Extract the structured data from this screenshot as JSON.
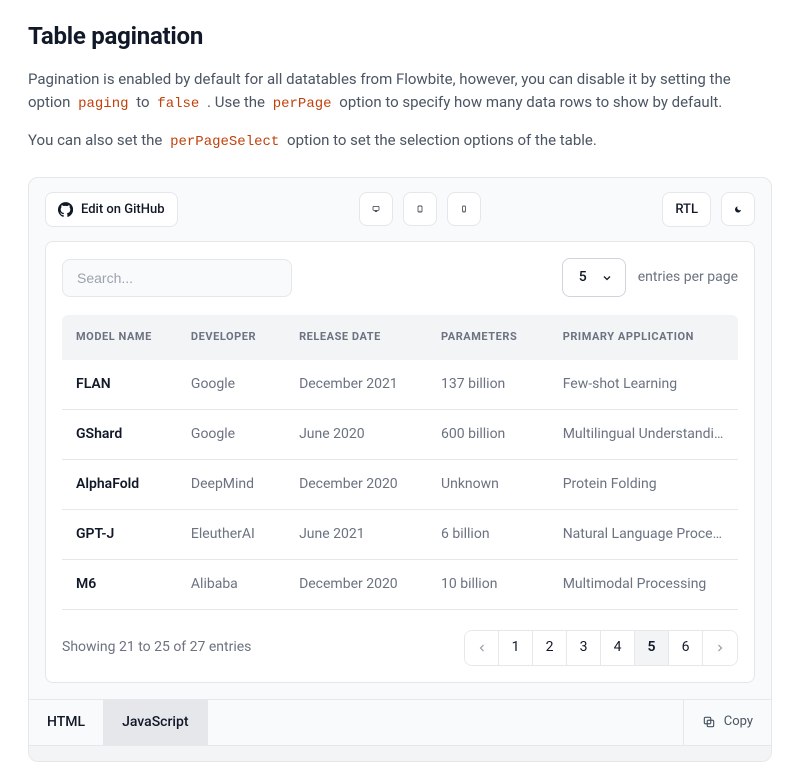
{
  "heading": "Table pagination",
  "intro_segments": {
    "p1a": "Pagination is enabled by default for all datatables from Flowbite, however, you can disable it by setting the option ",
    "code_paging": "paging",
    "p1b": " to ",
    "code_false": "false",
    "p1c": ". Use the ",
    "code_perPage": "perPage",
    "p1d": " option to specify how many data rows to show by default.",
    "p2a": "You can also set the ",
    "code_perPageSelect": "perPageSelect",
    "p2b": " option to set the selection options of the table."
  },
  "toolbar": {
    "edit_label": "Edit on GitHub",
    "rtl_label": "RTL"
  },
  "search": {
    "placeholder": "Search..."
  },
  "per_page": {
    "value": "5",
    "label": "entries per page"
  },
  "columns": [
    "MODEL NAME",
    "DEVELOPER",
    "RELEASE DATE",
    "PARAMETERS",
    "PRIMARY APPLICATION"
  ],
  "col_widths": [
    "17%",
    "16%",
    "21%",
    "18%",
    "28%"
  ],
  "rows": [
    {
      "c": [
        "FLAN",
        "Google",
        "December 2021",
        "137 billion",
        "Few-shot Learning"
      ]
    },
    {
      "c": [
        "GShard",
        "Google",
        "June 2020",
        "600 billion",
        "Multilingual Understanding"
      ]
    },
    {
      "c": [
        "AlphaFold",
        "DeepMind",
        "December 2020",
        "Unknown",
        "Protein Folding"
      ]
    },
    {
      "c": [
        "GPT-J",
        "EleutherAI",
        "June 2021",
        "6 billion",
        "Natural Language Processing"
      ]
    },
    {
      "c": [
        "M6",
        "Alibaba",
        "December 2020",
        "10 billion",
        "Multimodal Processing"
      ]
    }
  ],
  "summary": "Showing 21 to 25 of 27 entries",
  "pages": [
    "1",
    "2",
    "3",
    "4",
    "5",
    "6"
  ],
  "active_page_index": 4,
  "codebar": {
    "tabs": [
      "HTML",
      "JavaScript"
    ],
    "active_index": 1,
    "copy_label": "Copy"
  }
}
